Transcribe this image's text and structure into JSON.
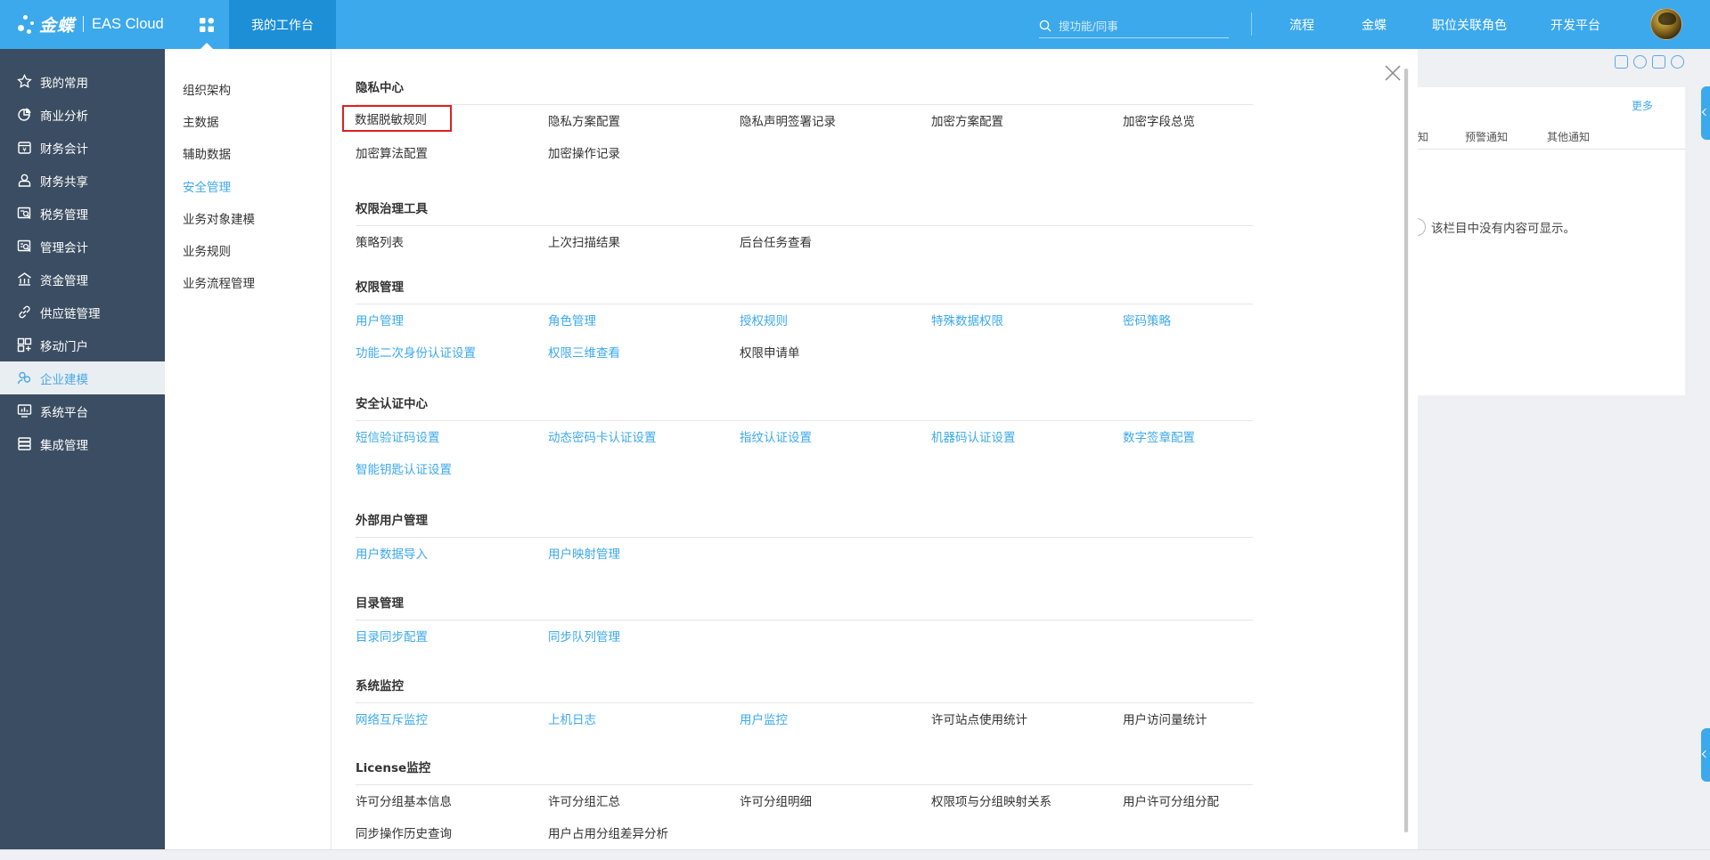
{
  "topbar": {
    "brand_logo": "金蝶",
    "brand_product": "EAS Cloud",
    "workbench_tab": "我的工作台",
    "search_placeholder": "搜功能/同事",
    "nav": [
      "流程",
      "金蝶",
      "职位关联角色",
      "开发平台"
    ]
  },
  "sidebar": {
    "items": [
      {
        "label": "我的常用",
        "icon": "star-icon"
      },
      {
        "label": "商业分析",
        "icon": "pie-chart-icon"
      },
      {
        "label": "财务会计",
        "icon": "ledger-icon"
      },
      {
        "label": "财务共享",
        "icon": "share-user-icon"
      },
      {
        "label": "税务管理",
        "icon": "tax-icon"
      },
      {
        "label": "管理会计",
        "icon": "report-icon"
      },
      {
        "label": "资金管理",
        "icon": "bank-icon"
      },
      {
        "label": "供应链管理",
        "icon": "link-icon"
      },
      {
        "label": "移动门户",
        "icon": "mobile-portal-icon"
      },
      {
        "label": "企业建模",
        "icon": "people-icon"
      },
      {
        "label": "系统平台",
        "icon": "monitor-icon"
      },
      {
        "label": "集成管理",
        "icon": "database-icon"
      }
    ],
    "active_index": 9
  },
  "submenu": {
    "items": [
      "组织架构",
      "主数据",
      "辅助数据",
      "安全管理",
      "业务对象建模",
      "业务规则",
      "业务流程管理"
    ],
    "active_index": 3
  },
  "panel": {
    "sections": [
      {
        "title": "隐私中心",
        "rows": [
          [
            {
              "t": "数据脱敏规则",
              "c": "dark",
              "boxed": true
            },
            {
              "t": "隐私方案配置",
              "c": "dark"
            },
            {
              "t": "隐私声明签署记录",
              "c": "dark"
            },
            {
              "t": "加密方案配置",
              "c": "dark"
            },
            {
              "t": "加密字段总览",
              "c": "dark"
            }
          ],
          [
            {
              "t": "加密算法配置",
              "c": "dark"
            },
            {
              "t": "加密操作记录",
              "c": "dark"
            }
          ]
        ]
      },
      {
        "title": "权限治理工具",
        "rows": [
          [
            {
              "t": "策略列表",
              "c": "dark"
            },
            {
              "t": "上次扫描结果",
              "c": "dark"
            },
            {
              "t": "后台任务查看",
              "c": "dark"
            }
          ]
        ]
      },
      {
        "title": "权限管理",
        "rows": [
          [
            {
              "t": "用户管理",
              "c": "blue"
            },
            {
              "t": "角色管理",
              "c": "blue"
            },
            {
              "t": "授权规则",
              "c": "blue"
            },
            {
              "t": "特殊数据权限",
              "c": "blue"
            },
            {
              "t": "密码策略",
              "c": "blue"
            }
          ],
          [
            {
              "t": "功能二次身份认证设置",
              "c": "blue"
            },
            {
              "t": "权限三维查看",
              "c": "blue"
            },
            {
              "t": "权限申请单",
              "c": "dark"
            }
          ]
        ]
      },
      {
        "title": "安全认证中心",
        "rows": [
          [
            {
              "t": "短信验证码设置",
              "c": "blue"
            },
            {
              "t": "动态密码卡认证设置",
              "c": "blue"
            },
            {
              "t": "指纹认证设置",
              "c": "blue"
            },
            {
              "t": "机器码认证设置",
              "c": "blue"
            },
            {
              "t": "数字签章配置",
              "c": "blue"
            }
          ],
          [
            {
              "t": "智能钥匙认证设置",
              "c": "blue"
            }
          ]
        ]
      },
      {
        "title": "外部用户管理",
        "rows": [
          [
            {
              "t": "用户数据导入",
              "c": "blue"
            },
            {
              "t": "用户映射管理",
              "c": "blue"
            }
          ]
        ]
      },
      {
        "title": "目录管理",
        "rows": [
          [
            {
              "t": "目录同步配置",
              "c": "blue"
            },
            {
              "t": "同步队列管理",
              "c": "blue"
            }
          ]
        ]
      },
      {
        "title": "系统监控",
        "rows": [
          [
            {
              "t": "网络互斥监控",
              "c": "blue"
            },
            {
              "t": "上机日志",
              "c": "blue"
            },
            {
              "t": "用户监控",
              "c": "blue"
            },
            {
              "t": "许可站点使用统计",
              "c": "dark"
            },
            {
              "t": "用户访问量统计",
              "c": "dark"
            }
          ]
        ]
      },
      {
        "title": "License监控",
        "rows": [
          [
            {
              "t": "许可分组基本信息",
              "c": "dark"
            },
            {
              "t": "许可分组汇总",
              "c": "dark"
            },
            {
              "t": "许可分组明细",
              "c": "dark"
            },
            {
              "t": "权限项与分组映射关系",
              "c": "dark"
            },
            {
              "t": "用户许可分组分配",
              "c": "dark"
            }
          ],
          [
            {
              "t": "同步操作历史查询",
              "c": "dark"
            },
            {
              "t": "用户占用分组差异分析",
              "c": "dark"
            }
          ]
        ]
      }
    ]
  },
  "background": {
    "more": "更多",
    "tabs": [
      "知",
      "预警通知",
      "其他通知"
    ],
    "empty_message": "该栏目中没有内容可显示。"
  },
  "colors": {
    "accent": "#3ca9ec",
    "sidebar_bg": "#3b4d62",
    "highlight_border": "#e02020"
  }
}
